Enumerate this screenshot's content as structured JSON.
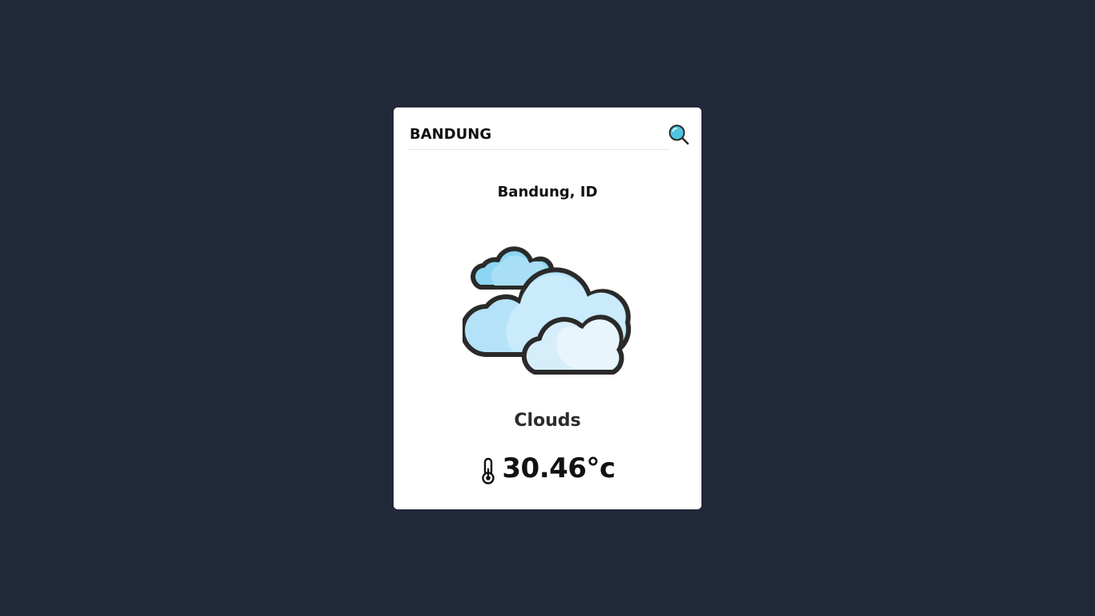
{
  "search": {
    "value": "BANDUNG",
    "icon": "search-icon"
  },
  "location": "Bandung, ID",
  "weather": {
    "icon": "clouds-icon",
    "condition": "Clouds",
    "temperature": "30.46°c",
    "temperature_icon": "thermometer-icon"
  },
  "colors": {
    "background": "#212838",
    "card": "#ffffff",
    "accent": "#4fc3e0",
    "cloud_light": "#c6e9fb",
    "cloud_mid": "#a9dcf6",
    "outline": "#2a2a2a"
  }
}
